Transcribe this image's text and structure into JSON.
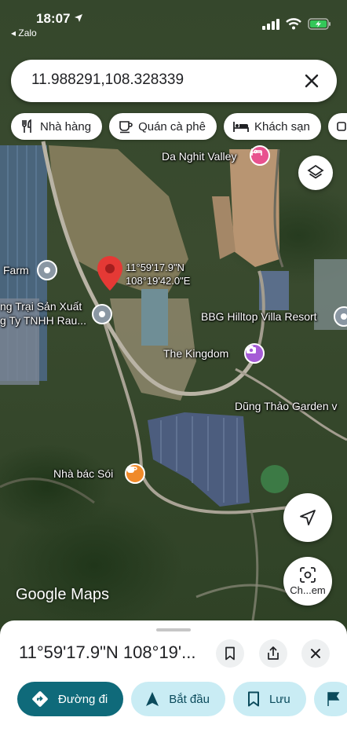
{
  "status_bar": {
    "time": "18:07",
    "back_app": "◂ Zalo",
    "icons": [
      "location-arrow-icon",
      "signal-icon",
      "wifi-icon",
      "battery-charging-icon"
    ]
  },
  "search": {
    "value": "11.988291,108.328339"
  },
  "chips": [
    {
      "label": "Nhà hàng",
      "icon": "restaurant-icon"
    },
    {
      "label": "Quán cà phê",
      "icon": "coffee-icon"
    },
    {
      "label": "Khách sạn",
      "icon": "hotel-icon"
    }
  ],
  "map": {
    "pin": {
      "line1": "11°59'17.9\"N",
      "line2": "108°19'42.0\"E"
    },
    "places": {
      "da_nghit": "Da Nghit Valley",
      "farm": "Farm",
      "trang_trai_1": "ng Trại Sản Xuất",
      "trang_trai_2": "g Ty TNHH Rau...",
      "bbg": "BBG Hilltop Villa Resort",
      "kingdom": "The Kingdom",
      "dung_thao": "Dũng Thảo Garden v",
      "nha_bac_soi": "Nhà bác Sói"
    },
    "watermark": {
      "google": "Google",
      "maps": "Maps"
    },
    "scan_button_label": "Ch...em"
  },
  "sheet": {
    "title": "11°59'17.9\"N 108°19'...",
    "actions": [
      {
        "label": "Đường đi",
        "icon": "directions-icon"
      },
      {
        "label": "Bắt đầu",
        "icon": "navigate-icon"
      },
      {
        "label": "Lưu",
        "icon": "bookmark-icon"
      },
      {
        "label": "",
        "icon": "flag-icon"
      }
    ]
  },
  "colors": {
    "primary_action": "#0f6a7a",
    "secondary_action": "#c9ecf4",
    "pin": "#e53935",
    "hotel_poi": "#e8528f",
    "attraction_poi": "#a55bd6",
    "cafe_poi": "#f08a2a"
  }
}
